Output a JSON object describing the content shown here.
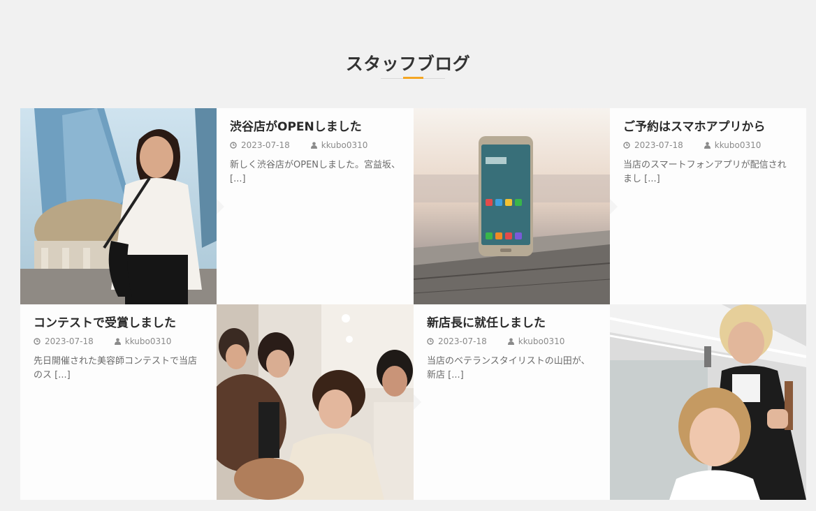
{
  "section": {
    "title": "スタッフブログ"
  },
  "posts": [
    {
      "title": "渋谷店がOPENしました",
      "date": "2023-07-18",
      "author": "kkubo0310",
      "excerpt": "新しく渋谷店がOPENしました。宮益坂、[...]",
      "image_icon": "businesswoman-photo"
    },
    {
      "title": "ご予約はスマホアプリから",
      "date": "2023-07-18",
      "author": "kkubo0310",
      "excerpt": "当店のスマートフォンアプリが配信されまし [...]",
      "image_icon": "smartphone-photo"
    },
    {
      "title": "コンテストで受賞しました",
      "date": "2023-07-18",
      "author": "kkubo0310",
      "excerpt": "先日開催された美容師コンテストで当店のス [...]",
      "image_icon": "hair-contest-photo"
    },
    {
      "title": "新店長に就任しました",
      "date": "2023-07-18",
      "author": "kkubo0310",
      "excerpt": "当店のベテランスタイリストの山田が、新店 [...]",
      "image_icon": "stylist-photo"
    }
  ],
  "colors": {
    "accent": "#f5a623",
    "background": "#f1f1f1",
    "card": "#fdfdfd"
  }
}
